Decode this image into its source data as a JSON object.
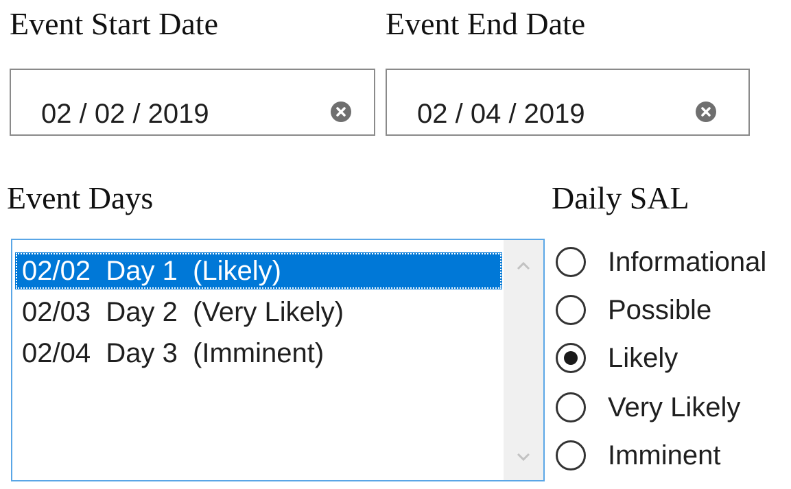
{
  "start_date": {
    "heading": "Event Start Date",
    "value": "02 / 02 / 2019",
    "clear_icon": "clear-icon"
  },
  "end_date": {
    "heading": "Event End Date",
    "value": "02 / 04 / 2019",
    "clear_icon": "clear-icon"
  },
  "event_days": {
    "heading": "Event Days",
    "items": [
      {
        "label": "02/02  Day 1  (Likely)",
        "selected": true
      },
      {
        "label": "02/03  Day 2  (Very Likely)",
        "selected": false
      },
      {
        "label": "02/04  Day 3  (Imminent)",
        "selected": false
      }
    ],
    "scroll_up_icon": "chevron-up-icon",
    "scroll_down_icon": "chevron-down-icon"
  },
  "daily_sal": {
    "heading": "Daily SAL",
    "options": [
      {
        "label": "Informational",
        "checked": false
      },
      {
        "label": "Possible",
        "checked": false
      },
      {
        "label": "Likely",
        "checked": true
      },
      {
        "label": "Very Likely",
        "checked": false
      },
      {
        "label": "Imminent",
        "checked": false
      }
    ]
  },
  "colors": {
    "selection": "#0078d7",
    "listbox_border": "#5aa6e6",
    "field_border": "#8a8a8a"
  }
}
